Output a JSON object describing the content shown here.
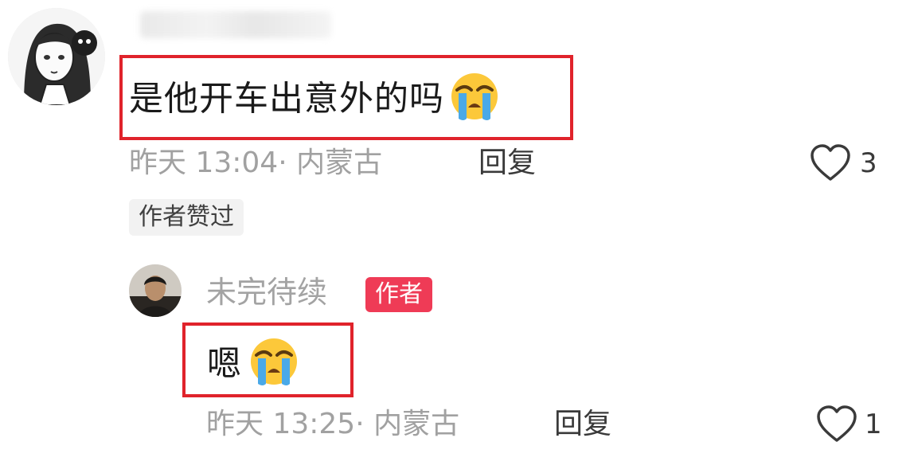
{
  "comment": {
    "text": "是他开车出意外的吗",
    "emoji": "loudly-crying-face",
    "time": "昨天 13:04",
    "location": "内蒙古",
    "reply_label": "回复",
    "likes": "3",
    "author_liked_label": "作者赞过"
  },
  "reply": {
    "username": "未完待续",
    "author_badge": "作者",
    "text": "嗯",
    "emoji": "loudly-crying-face",
    "time": "昨天 13:25",
    "location": "内蒙古",
    "reply_label": "回复",
    "likes": "1"
  },
  "colors": {
    "highlight_box": "#e0232b",
    "author_badge_bg": "#ef3b56",
    "meta_text": "#a1a1a1"
  }
}
